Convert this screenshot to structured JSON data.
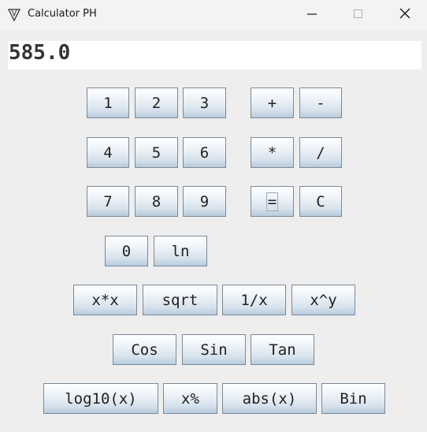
{
  "window": {
    "title": "Calculator PH"
  },
  "display": {
    "value": "585.0"
  },
  "buttons": {
    "b1": "1",
    "b2": "2",
    "b3": "3",
    "plus": "+",
    "minus": "-",
    "b4": "4",
    "b5": "5",
    "b6": "6",
    "mul": "*",
    "div": "/",
    "b7": "7",
    "b8": "8",
    "b9": "9",
    "eq": "=",
    "clear": "C",
    "b0": "0",
    "ln": "ln",
    "square": "x*x",
    "sqrt": "sqrt",
    "reciprocal": "1/x",
    "power": "x^y",
    "cos": "Cos",
    "sin": "Sin",
    "tan": "Tan",
    "log10": "log10(x)",
    "percent": "x%",
    "abs": "abs(x)",
    "bin": "Bin"
  }
}
